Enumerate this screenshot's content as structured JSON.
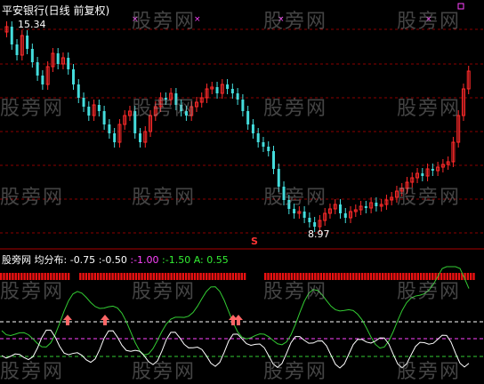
{
  "upper_panel": {
    "title": "平安银行(日线 前复权)",
    "high_label": "15.34",
    "low_label": "8.97",
    "s_marker": "S"
  },
  "lower_panel": {
    "label": "股旁网",
    "indicator": "均分布:",
    "values": [
      {
        "text": "-0.75",
        "color": "#ffffff"
      },
      {
        "text": ":-0.50",
        "color": "#ffffff"
      },
      {
        "text": ":-1.00",
        "color": "#ff44ff"
      },
      {
        "text": ":-1.50",
        "color": "#33ee33"
      },
      {
        "text": "A: 0.55",
        "color": "#33ee33"
      }
    ]
  },
  "watermark": "股旁网",
  "colors": {
    "up": "#ff2a2a",
    "down": "#44dddd",
    "title": "#ffffff",
    "grid": "#8b0000",
    "magenta": "#ff44ff",
    "green": "#33cc33",
    "white_line": "#ffffff",
    "red_bar": "#ee1111"
  }
}
